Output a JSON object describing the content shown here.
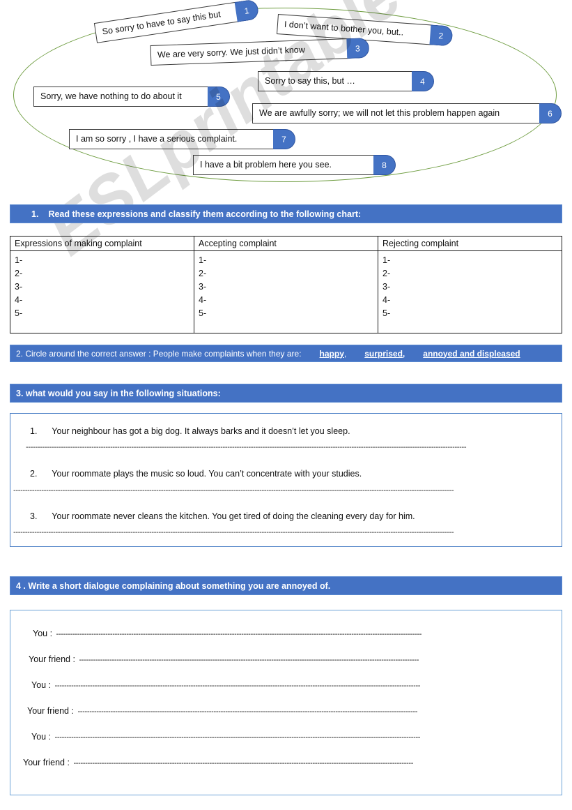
{
  "colors": {
    "bar_blue": "#4472C4",
    "badge_blue": "#4472C4",
    "ellipse_green": "#6f9d41",
    "box_border_blue": "#4a7fc6"
  },
  "watermark": {
    "text": "ESLprintables.com"
  },
  "callouts": [
    {
      "number": "1",
      "text": "So sorry to have to say this but"
    },
    {
      "number": "2",
      "text": "I don’t want to bother you, but.."
    },
    {
      "number": "3",
      "text": "We are very sorry. We just didn’t know"
    },
    {
      "number": "4",
      "text": "Sorry to say this, but …"
    },
    {
      "number": "5",
      "text": "Sorry, we have nothing to do about it"
    },
    {
      "number": "6",
      "text": "We are awfully sorry; we will not let this problem happen again"
    },
    {
      "number": "7",
      "text": "I am so sorry , I have a serious complaint."
    },
    {
      "number": "8",
      "text": "I have a bit problem here you see."
    }
  ],
  "task1": {
    "number": "1.",
    "instruction": "Read these expressions and classify them according to the following chart:",
    "table": {
      "headers": [
        "Expressions of making complaint",
        "Accepting complaint",
        "Rejecting complaint"
      ],
      "rows": [
        "1-",
        "2-",
        "3-",
        "4-",
        "5-"
      ]
    }
  },
  "task2": {
    "prompt": "2. Circle around the correct answer : People make complaints when they are:",
    "options": [
      "happy",
      "surprised,",
      "annoyed and displeased"
    ],
    "comma_after_first": ","
  },
  "task3": {
    "instruction": "3. what would you say in the following situations:",
    "situations": [
      {
        "number": "1.",
        "text": "Your neighbour has got a big dog. It always barks and it doesn’t let you sleep."
      },
      {
        "number": "2.",
        "text": "Your roommate plays the music so loud. You can’t concentrate with your studies."
      },
      {
        "number": "3.",
        "text": "Your roommate never cleans the kitchen. You get tired of doing the cleaning every day for him."
      }
    ],
    "answer_line": "--------------------------------------------------------------------------------------------------------------------------------------------------------------------------------------------"
  },
  "task4": {
    "instruction": "4 . Write a short dialogue complaining   about something you are annoyed of.",
    "dialogue": [
      {
        "speaker": "You :",
        "line": "------------------------------------------------------------------------------------------------------------------------------------------------------------"
      },
      {
        "speaker": "Your friend :",
        "line": "-------------------------------------------------------------------------------------------------------------------------------------------------"
      },
      {
        "speaker": "You :",
        "line": "------------------------------------------------------------------------------------------------------------------------------------------------------------"
      },
      {
        "speaker": "Your friend :",
        "line": "-------------------------------------------------------------------------------------------------------------------------------------------------"
      },
      {
        "speaker": "You :",
        "line": "------------------------------------------------------------------------------------------------------------------------------------------------------------"
      },
      {
        "speaker": "Your friend :",
        "line": "-------------------------------------------------------------------------------------------------------------------------------------------------"
      }
    ]
  }
}
